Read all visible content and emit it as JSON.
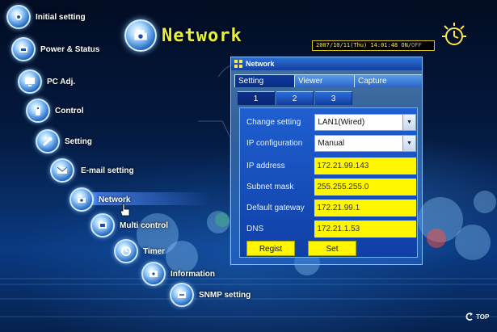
{
  "menu": {
    "items": [
      {
        "label": "Initial setting"
      },
      {
        "label": "Power & Status"
      },
      {
        "label": "PC Adj."
      },
      {
        "label": "Control"
      },
      {
        "label": "Setting"
      },
      {
        "label": "E-mail setting"
      },
      {
        "label": "Network"
      },
      {
        "label": "Multi control"
      },
      {
        "label": "Timer"
      },
      {
        "label": "Information"
      },
      {
        "label": "SNMP setting"
      }
    ]
  },
  "header": {
    "title": "Network",
    "datetime": "2007/10/11(Thu) 14:01:48",
    "status_on": "ON",
    "status_off": "OFF"
  },
  "panel": {
    "title": "Network",
    "tabs": [
      "Setting",
      "Viewer",
      "Capture"
    ],
    "subtabs": [
      "1",
      "2",
      "3"
    ],
    "fields": {
      "change_setting": {
        "label": "Change setting",
        "value": "LAN1(Wired)"
      },
      "ip_configuration": {
        "label": "IP configuration",
        "value": "Manual"
      },
      "ip_address": {
        "label": "IP address",
        "value": "172.21.99.143"
      },
      "subnet_mask": {
        "label": "Subnet mask",
        "value": "255.255.255.0"
      },
      "default_gateway": {
        "label": "Default gateway",
        "value": "172.21.99.1"
      },
      "dns": {
        "label": "DNS",
        "value": "172.21.1.53"
      }
    },
    "buttons": {
      "regist": "Regist",
      "set": "Set"
    }
  },
  "footer": {
    "top_label": "TOP"
  }
}
